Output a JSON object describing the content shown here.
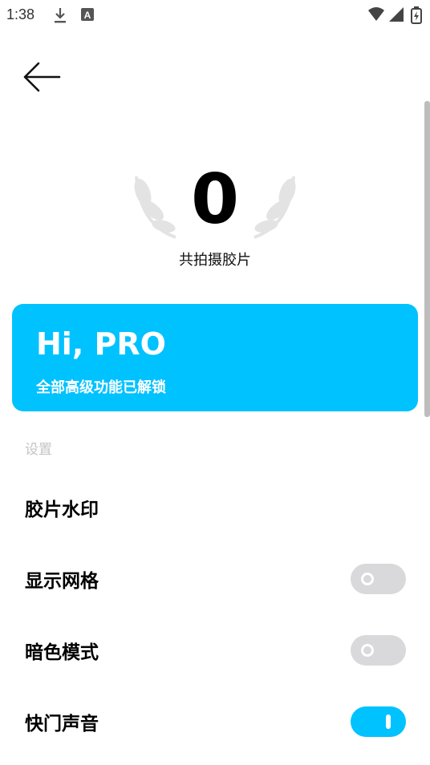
{
  "status_bar": {
    "time": "1:38",
    "icons": [
      "download-icon",
      "a-badge-icon",
      "wifi-icon",
      "cellular-icon",
      "battery-icon"
    ]
  },
  "nav": {
    "back_icon": "arrow-left-icon"
  },
  "stats": {
    "count": "0",
    "label": "共拍摄胶片"
  },
  "pro_card": {
    "title": "Hi, PRO",
    "subtitle": "全部高级功能已解锁",
    "color": "#00c2ff"
  },
  "settings": {
    "header": "设置",
    "items": [
      {
        "label": "胶片水印"
      },
      {
        "label": "显示网格",
        "toggle": "off"
      },
      {
        "label": "暗色模式",
        "toggle": "off"
      },
      {
        "label": "快门声音",
        "toggle": "on"
      }
    ]
  },
  "colors": {
    "accent": "#00c2ff",
    "toggle_off": "#d9d9db",
    "muted_text": "#c4c4c4"
  }
}
